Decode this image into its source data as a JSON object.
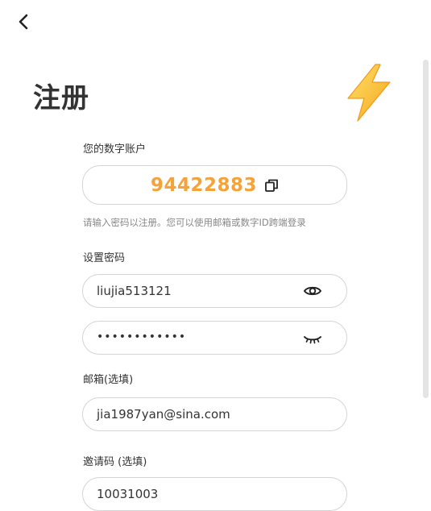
{
  "header": {
    "back_icon": "chevron-left-icon",
    "title": "注册",
    "logo_icon": "lightning-bolt-icon"
  },
  "account": {
    "label": "您的数字账户",
    "number": "94422883",
    "copy_icon": "copy-icon",
    "accent_color": "#f5a23a",
    "hint": "请输入密码以注册。您可以使用邮箱或数字ID跨端登录"
  },
  "password": {
    "label": "设置密码",
    "value": "liujia513121",
    "visible_icon": "eye-open-icon",
    "confirm_masked": "••••••••••••",
    "hidden_icon": "eye-closed-icon"
  },
  "email": {
    "label": "邮箱(选填)",
    "value": "jia1987yan@sina.com"
  },
  "invite": {
    "label": "邀请码 (选填)",
    "value": "10031003"
  }
}
